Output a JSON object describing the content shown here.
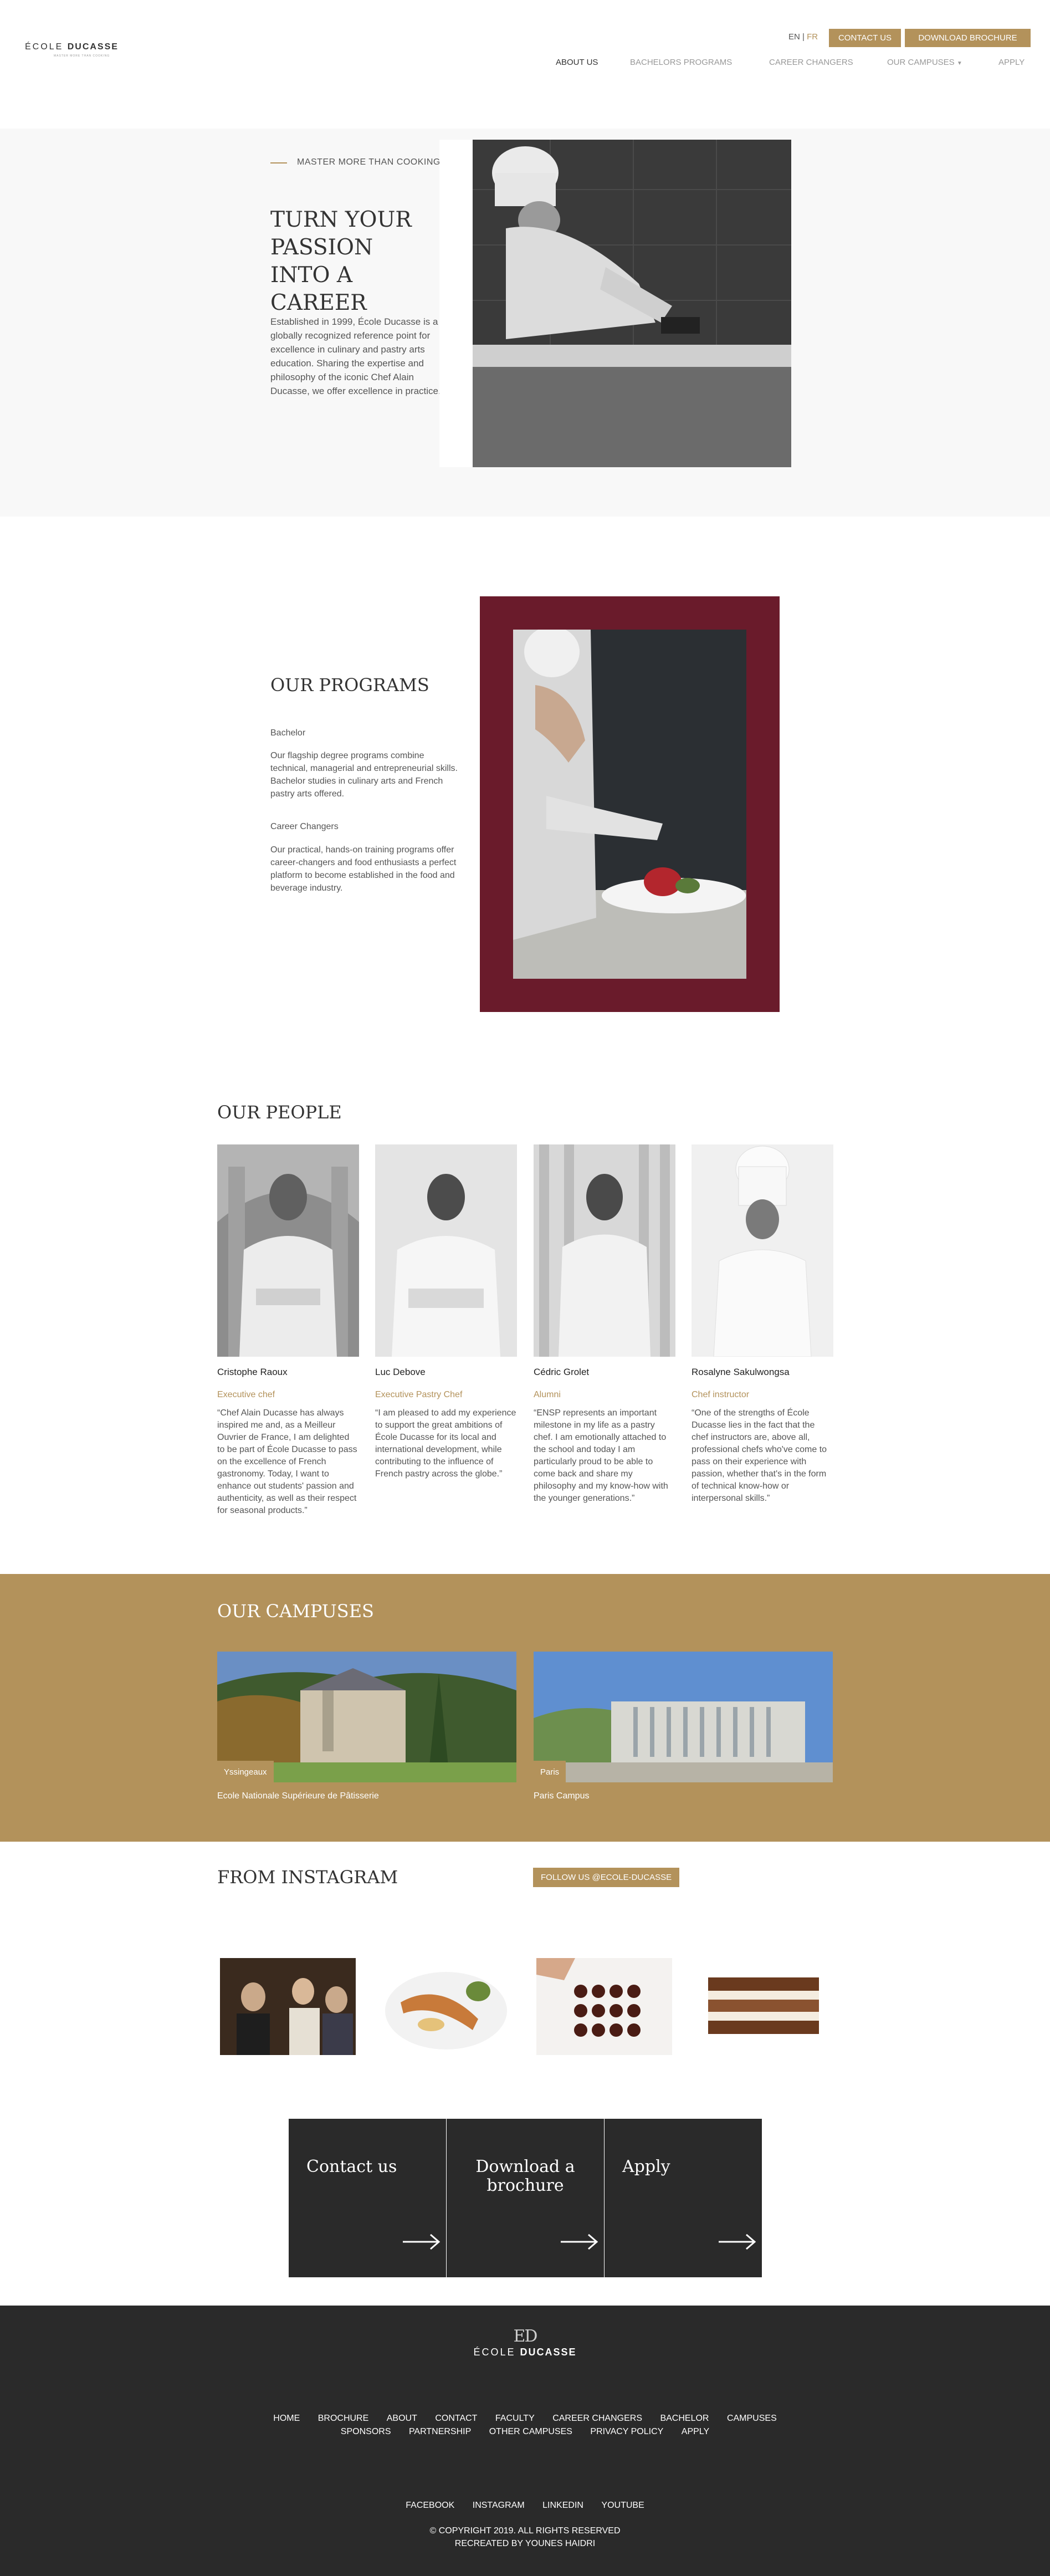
{
  "header": {
    "logo": {
      "wordmark_a": "ÉCOLE",
      "wordmark_b": "DUCASSE",
      "tagline": "MASTER MORE THAN COOKING"
    },
    "lang": {
      "en": "EN",
      "sep": "|",
      "fr": "FR"
    },
    "contact_label": "CONTACT US",
    "brochure_label": "DOWNLOAD BROCHURE",
    "nav": [
      "ABOUT US",
      "BACHELORS PROGRAMS",
      "CAREER CHANGERS",
      "OUR CAMPUSES",
      "APPLY"
    ]
  },
  "hero": {
    "eyebrow": "MASTER MORE THAN COOKING",
    "title": "TURN YOUR PASSION INTO A CAREER",
    "text": "Established in 1999, École Ducasse is a globally recognized reference point for excellence in culinary and pastry arts education. Sharing the expertise and philosophy of the iconic Chef Alain Ducasse, we offer excellence in practice."
  },
  "programs": {
    "title": "OUR PROGRAMS",
    "items": [
      {
        "name": "Bachelor",
        "text": "Our flagship degree programs combine technical, managerial and entrepreneurial skills. Bachelor studies in culinary arts and French pastry arts offered."
      },
      {
        "name": "Career Changers",
        "text": "Our practical, hands-on training programs offer career-changers and food enthusiasts a perfect platform to become established in the food and beverage industry."
      }
    ]
  },
  "people": {
    "title": "OUR PEOPLE",
    "items": [
      {
        "name": "Cristophe Raoux",
        "role": "Executive chef",
        "quote": "“Chef Alain Ducasse has always inspired me and, as a Meilleur Ouvrier de France, I am delighted to be part of École Ducasse to pass on the excellence of French gastronomy. Today, I want to enhance out students' passion and authenticity, as well as their respect for seasonal products.”"
      },
      {
        "name": "Luc Debove",
        "role": "Executive Pastry Chef",
        "quote": "“I am pleased to add my experience to support the great ambitions of École Ducasse for its local and international development, while contributing to the influence of French pastry across the globe.”"
      },
      {
        "name": "Cédric Grolet",
        "role": "Alumni",
        "quote": "“ENSP represents an important milestone in my life as a pastry chef. I am emotionally attached to the school and today I am particularly proud to be able to come back and share my philosophy and my know-how with the younger generations.”"
      },
      {
        "name": "Rosalyne Sakulwongsa",
        "role": "Chef instructor",
        "quote": "“One of the strengths of École Ducasse lies in the fact that the chef instructors are, above all, professional chefs who've come to pass on their experience with passion, whether that's in the form of technical know-how or interpersonal skills.”"
      }
    ]
  },
  "campuses": {
    "title": "OUR CAMPUSES",
    "items": [
      {
        "tag": "Yssingeaux",
        "caption": "Ecole Nationale Supérieure de Pâtisserie"
      },
      {
        "tag": "Paris",
        "caption": "Paris Campus"
      }
    ]
  },
  "instagram": {
    "title": "FROM INSTAGRAM",
    "follow_label": "FOLLOW US @ECOLE-DUCASSE"
  },
  "cta": {
    "contact": "Contact us",
    "brochure": "Download a brochure",
    "apply": "Apply"
  },
  "footer": {
    "logo_mono": "ED",
    "links_row1": [
      "HOME",
      "BROCHURE",
      "ABOUT",
      "CONTACT",
      "FACULTY",
      "CAREER CHANGERS",
      "BACHELOR",
      "CAMPUSES"
    ],
    "links_row2": [
      "SPONSORS",
      "PARTNERSHIP",
      "OTHER CAMPUSES",
      "PRIVACY POLICY",
      "APPLY"
    ],
    "social": [
      "FACEBOOK",
      "INSTAGRAM",
      "LINKEDIN",
      "YOUTUBE"
    ],
    "copyright": "© COPYRIGHT 2019. ALL RIGHTS RESERVED",
    "credit": "RECREATED BY YOUNES HAIDRI"
  },
  "colors": {
    "gold": "#b3925b",
    "burgundy": "#6a1b2b",
    "dark": "#2a2a2a",
    "light_bg": "#f8f8f8"
  }
}
